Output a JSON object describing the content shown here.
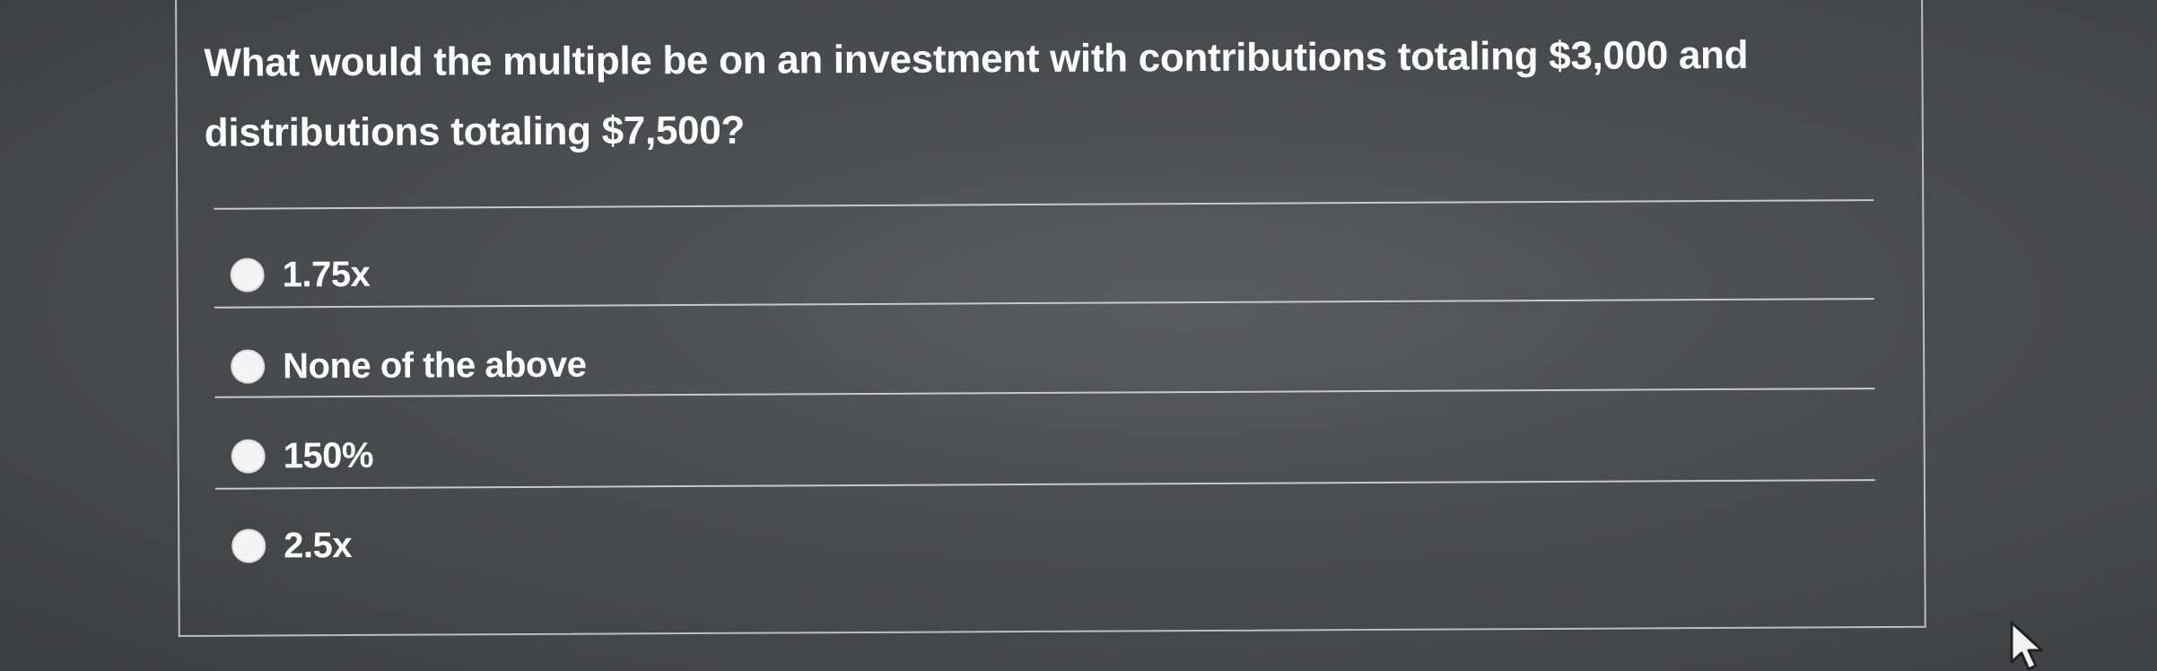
{
  "question": {
    "line1": "What would the multiple be on an investment with contributions totaling $3,000 and",
    "line2": "distributions totaling $7,500?"
  },
  "options": [
    {
      "label": "1.75x"
    },
    {
      "label": "None of the above"
    },
    {
      "label": "150%"
    },
    {
      "label": "2.5x"
    }
  ],
  "cursor_icon": "mouse-pointer-icon"
}
